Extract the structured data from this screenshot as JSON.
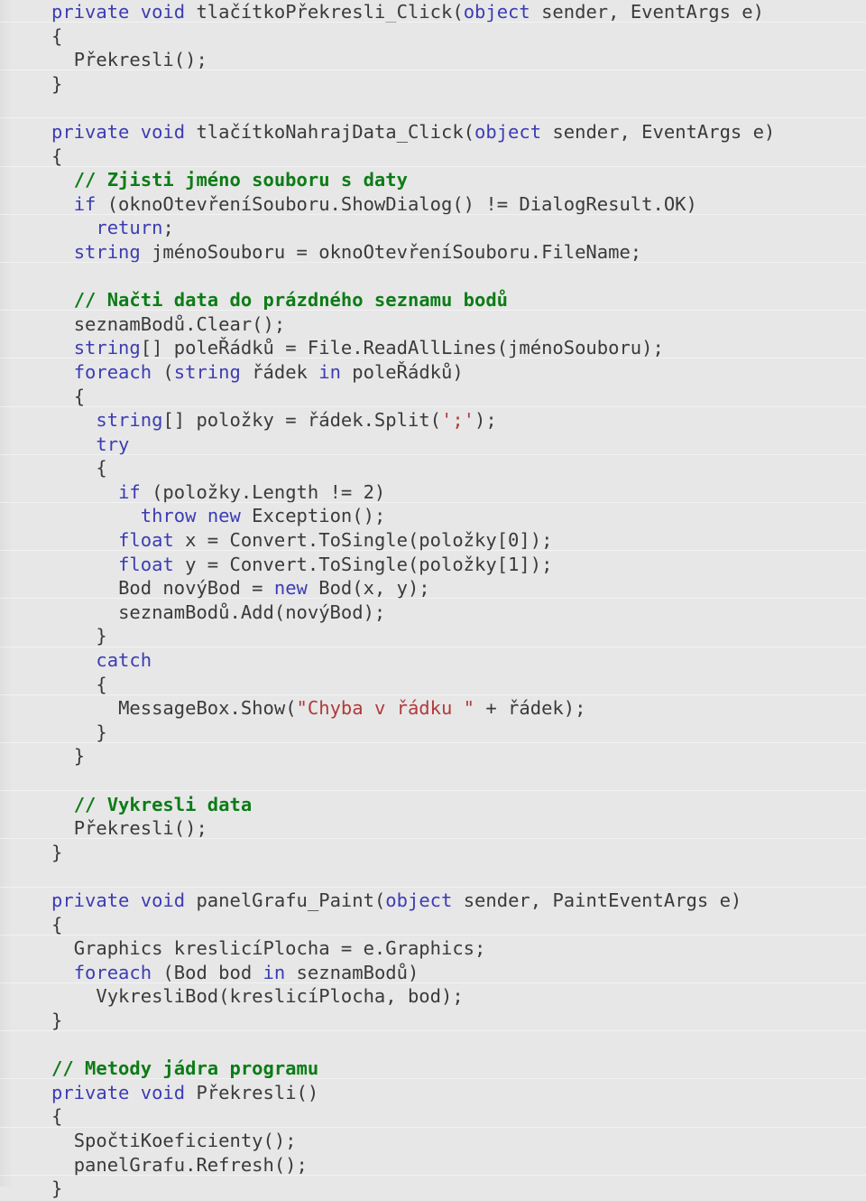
{
  "document": {
    "title": "C# source code listing",
    "language": "csharp",
    "background_color": "#e7e7e7",
    "colors": {
      "keyword": "#3c3cb4",
      "comment": "#0c7c16",
      "string": "#b03a3a",
      "plain": "#3a3a3a"
    }
  },
  "lines": [
    {
      "indent": 0,
      "tokens": [
        {
          "t": "kw",
          "s": "private"
        },
        {
          "t": "plain",
          "s": " "
        },
        {
          "t": "kw",
          "s": "void"
        },
        {
          "t": "plain",
          "s": " tlačítkoPřekresli_Click("
        },
        {
          "t": "kw",
          "s": "object"
        },
        {
          "t": "plain",
          "s": " sender, EventArgs e)"
        }
      ]
    },
    {
      "indent": 0,
      "tokens": [
        {
          "t": "plain",
          "s": "{"
        }
      ]
    },
    {
      "indent": 1,
      "tokens": [
        {
          "t": "plain",
          "s": "Překresli();"
        }
      ]
    },
    {
      "indent": 0,
      "tokens": [
        {
          "t": "plain",
          "s": "}"
        }
      ]
    },
    {
      "indent": 0,
      "tokens": []
    },
    {
      "indent": 0,
      "tokens": [
        {
          "t": "kw",
          "s": "private"
        },
        {
          "t": "plain",
          "s": " "
        },
        {
          "t": "kw",
          "s": "void"
        },
        {
          "t": "plain",
          "s": " tlačítkoNahrajData_Click("
        },
        {
          "t": "kw",
          "s": "object"
        },
        {
          "t": "plain",
          "s": " sender, EventArgs e)"
        }
      ]
    },
    {
      "indent": 0,
      "tokens": [
        {
          "t": "plain",
          "s": "{"
        }
      ]
    },
    {
      "indent": 1,
      "tokens": [
        {
          "t": "cmt",
          "s": "// Zjisti jméno souboru s daty"
        }
      ]
    },
    {
      "indent": 1,
      "tokens": [
        {
          "t": "kw",
          "s": "if"
        },
        {
          "t": "plain",
          "s": " (oknoOtevřeníSouboru.ShowDialog() != DialogResult.OK)"
        }
      ]
    },
    {
      "indent": 2,
      "tokens": [
        {
          "t": "kw",
          "s": "return"
        },
        {
          "t": "plain",
          "s": ";"
        }
      ]
    },
    {
      "indent": 1,
      "tokens": [
        {
          "t": "kw",
          "s": "string"
        },
        {
          "t": "plain",
          "s": " jménoSouboru = oknoOtevřeníSouboru.FileName;"
        }
      ]
    },
    {
      "indent": 0,
      "tokens": []
    },
    {
      "indent": 1,
      "tokens": [
        {
          "t": "cmt",
          "s": "// Načti data do prázdného seznamu bodů"
        }
      ]
    },
    {
      "indent": 1,
      "tokens": [
        {
          "t": "plain",
          "s": "seznamBodů.Clear();"
        }
      ]
    },
    {
      "indent": 1,
      "tokens": [
        {
          "t": "kw",
          "s": "string"
        },
        {
          "t": "plain",
          "s": "[] poleŘádků = File.ReadAllLines(jménoSouboru);"
        }
      ]
    },
    {
      "indent": 1,
      "tokens": [
        {
          "t": "kw",
          "s": "foreach"
        },
        {
          "t": "plain",
          "s": " ("
        },
        {
          "t": "kw",
          "s": "string"
        },
        {
          "t": "plain",
          "s": " řádek "
        },
        {
          "t": "kw",
          "s": "in"
        },
        {
          "t": "plain",
          "s": " poleŘádků)"
        }
      ]
    },
    {
      "indent": 1,
      "tokens": [
        {
          "t": "plain",
          "s": "{"
        }
      ]
    },
    {
      "indent": 2,
      "tokens": [
        {
          "t": "kw",
          "s": "string"
        },
        {
          "t": "plain",
          "s": "[] položky = řádek.Split("
        },
        {
          "t": "str",
          "s": "';'"
        },
        {
          "t": "plain",
          "s": ");"
        }
      ]
    },
    {
      "indent": 2,
      "tokens": [
        {
          "t": "kw",
          "s": "try"
        }
      ]
    },
    {
      "indent": 2,
      "tokens": [
        {
          "t": "plain",
          "s": "{"
        }
      ]
    },
    {
      "indent": 3,
      "tokens": [
        {
          "t": "kw",
          "s": "if"
        },
        {
          "t": "plain",
          "s": " (položky.Length != 2)"
        }
      ]
    },
    {
      "indent": 4,
      "tokens": [
        {
          "t": "kw",
          "s": "throw"
        },
        {
          "t": "plain",
          "s": " "
        },
        {
          "t": "kw",
          "s": "new"
        },
        {
          "t": "plain",
          "s": " Exception();"
        }
      ]
    },
    {
      "indent": 3,
      "tokens": [
        {
          "t": "kw",
          "s": "float"
        },
        {
          "t": "plain",
          "s": " x = Convert.ToSingle(položky[0]);"
        }
      ]
    },
    {
      "indent": 3,
      "tokens": [
        {
          "t": "kw",
          "s": "float"
        },
        {
          "t": "plain",
          "s": " y = Convert.ToSingle(položky[1]);"
        }
      ]
    },
    {
      "indent": 3,
      "tokens": [
        {
          "t": "plain",
          "s": "Bod novýBod = "
        },
        {
          "t": "kw",
          "s": "new"
        },
        {
          "t": "plain",
          "s": " Bod(x, y);"
        }
      ]
    },
    {
      "indent": 3,
      "tokens": [
        {
          "t": "plain",
          "s": "seznamBodů.Add(novýBod);"
        }
      ]
    },
    {
      "indent": 2,
      "tokens": [
        {
          "t": "plain",
          "s": "}"
        }
      ]
    },
    {
      "indent": 2,
      "tokens": [
        {
          "t": "kw",
          "s": "catch"
        }
      ]
    },
    {
      "indent": 2,
      "tokens": [
        {
          "t": "plain",
          "s": "{"
        }
      ]
    },
    {
      "indent": 3,
      "tokens": [
        {
          "t": "plain",
          "s": "MessageBox.Show("
        },
        {
          "t": "str",
          "s": "\"Chyba v řádku \""
        },
        {
          "t": "plain",
          "s": " + řádek);"
        }
      ]
    },
    {
      "indent": 2,
      "tokens": [
        {
          "t": "plain",
          "s": "}"
        }
      ]
    },
    {
      "indent": 1,
      "tokens": [
        {
          "t": "plain",
          "s": "}"
        }
      ]
    },
    {
      "indent": 0,
      "tokens": []
    },
    {
      "indent": 1,
      "tokens": [
        {
          "t": "cmt",
          "s": "// Vykresli data"
        }
      ]
    },
    {
      "indent": 1,
      "tokens": [
        {
          "t": "plain",
          "s": "Překresli();"
        }
      ]
    },
    {
      "indent": 0,
      "tokens": [
        {
          "t": "plain",
          "s": "}"
        }
      ]
    },
    {
      "indent": 0,
      "tokens": []
    },
    {
      "indent": 0,
      "tokens": [
        {
          "t": "kw",
          "s": "private"
        },
        {
          "t": "plain",
          "s": " "
        },
        {
          "t": "kw",
          "s": "void"
        },
        {
          "t": "plain",
          "s": " panelGrafu_Paint("
        },
        {
          "t": "kw",
          "s": "object"
        },
        {
          "t": "plain",
          "s": " sender, PaintEventArgs e)"
        }
      ]
    },
    {
      "indent": 0,
      "tokens": [
        {
          "t": "plain",
          "s": "{"
        }
      ]
    },
    {
      "indent": 1,
      "tokens": [
        {
          "t": "plain",
          "s": "Graphics kreslicíPlocha = e.Graphics;"
        }
      ]
    },
    {
      "indent": 1,
      "tokens": [
        {
          "t": "kw",
          "s": "foreach"
        },
        {
          "t": "plain",
          "s": " (Bod bod "
        },
        {
          "t": "kw",
          "s": "in"
        },
        {
          "t": "plain",
          "s": " seznamBodů)"
        }
      ]
    },
    {
      "indent": 2,
      "tokens": [
        {
          "t": "plain",
          "s": "VykresliBod(kreslicíPlocha, bod);"
        }
      ]
    },
    {
      "indent": 0,
      "tokens": [
        {
          "t": "plain",
          "s": "}"
        }
      ]
    },
    {
      "indent": 0,
      "tokens": []
    },
    {
      "indent": 0,
      "tokens": [
        {
          "t": "cmt",
          "s": "// Metody jádra programu"
        }
      ]
    },
    {
      "indent": 0,
      "tokens": [
        {
          "t": "kw",
          "s": "private"
        },
        {
          "t": "plain",
          "s": " "
        },
        {
          "t": "kw",
          "s": "void"
        },
        {
          "t": "plain",
          "s": " Překresli()"
        }
      ]
    },
    {
      "indent": 0,
      "tokens": [
        {
          "t": "plain",
          "s": "{"
        }
      ]
    },
    {
      "indent": 1,
      "tokens": [
        {
          "t": "plain",
          "s": "SpočtiKoeficienty();"
        }
      ]
    },
    {
      "indent": 1,
      "tokens": [
        {
          "t": "plain",
          "s": "panelGrafu.Refresh();"
        }
      ]
    },
    {
      "indent": 0,
      "tokens": [
        {
          "t": "plain",
          "s": "}"
        }
      ]
    }
  ]
}
